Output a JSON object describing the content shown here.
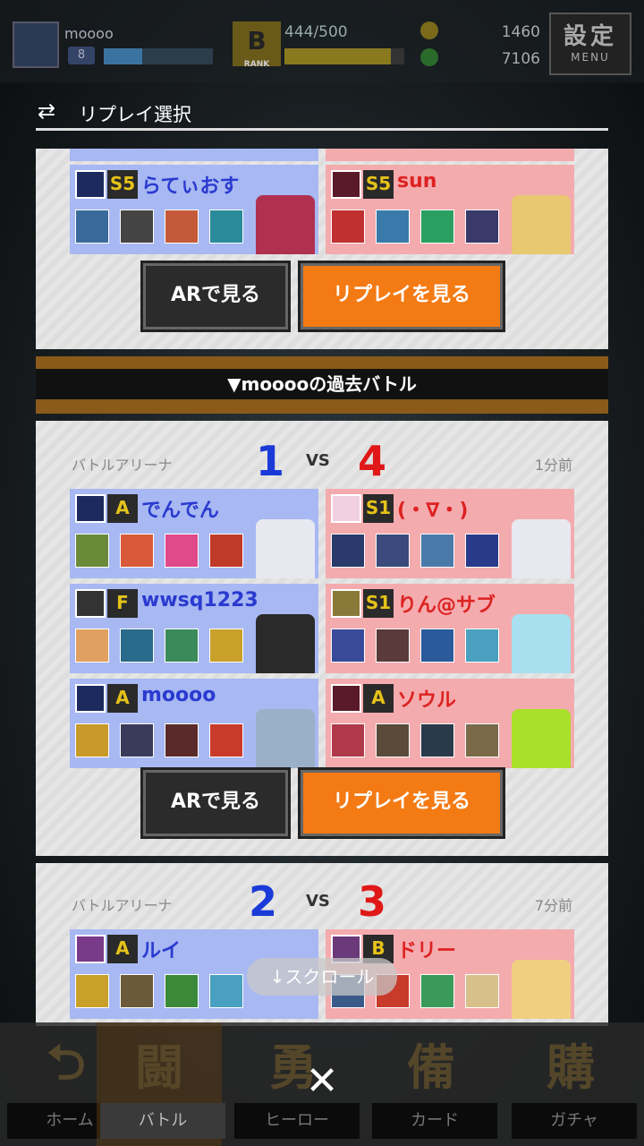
{
  "header": {
    "username": "moooo",
    "level": "8",
    "exp_fraction": 0.35,
    "rank": "B",
    "rank_label": "RANK",
    "stamina": "444/500",
    "stamina_fraction": 0.888,
    "coins": "1460",
    "gems": "7106",
    "settings_label": "設定",
    "settings_sub": "MENU"
  },
  "panel": {
    "title": "リプレイ選択",
    "title_icon": "replay-icon"
  },
  "prev_card": {
    "left_name": "らてぃおす",
    "left_rank": "S5",
    "right_name": "sun",
    "right_rank": "S5",
    "ar_label": "ARで見る",
    "replay_label": "リプレイを見る"
  },
  "divider": {
    "label": "▼mooooの過去バトル"
  },
  "battles": [
    {
      "mode": "バトルアリーナ",
      "score_left": "1",
      "vs": "VS",
      "score_right": "4",
      "ago": "1分前",
      "left": [
        {
          "name": "でんでん",
          "rank": "A"
        },
        {
          "name": "wwsq1223",
          "rank": "F"
        },
        {
          "name": "moooo",
          "rank": "A"
        }
      ],
      "right": [
        {
          "name": "(・∇・)",
          "rank": "S1"
        },
        {
          "name": "りん@サブ",
          "rank": "S1"
        },
        {
          "name": "ソウル",
          "rank": "A"
        }
      ],
      "ar_label": "ARで見る",
      "replay_label": "リプレイを見る"
    },
    {
      "mode": "バトルアリーナ",
      "score_left": "2",
      "vs": "VS",
      "score_right": "3",
      "ago": "7分前",
      "left": [
        {
          "name": "ルイ",
          "rank": "A"
        }
      ],
      "right": [
        {
          "name": "ドリー",
          "rank": "B"
        }
      ]
    }
  ],
  "scroll_hint": "↓スクロール",
  "nav": [
    {
      "icon": "home-icon",
      "big": "⮌",
      "label": "ホーム"
    },
    {
      "icon": "battle-icon",
      "big": "闘",
      "label": "バトル"
    },
    {
      "icon": "hero-icon",
      "big": "勇",
      "label": "ヒーロー"
    },
    {
      "icon": "card-icon",
      "big": "備",
      "label": "カード"
    },
    {
      "icon": "gacha-icon",
      "big": "購",
      "label": "ガチャ"
    }
  ],
  "close_glyph": "✕",
  "colors": {
    "team_blue": "#a7b8f2",
    "team_red": "#f4abae",
    "score_blue": "#1a3ad8",
    "score_red": "#e01818",
    "replay_button": "#f47a14"
  }
}
